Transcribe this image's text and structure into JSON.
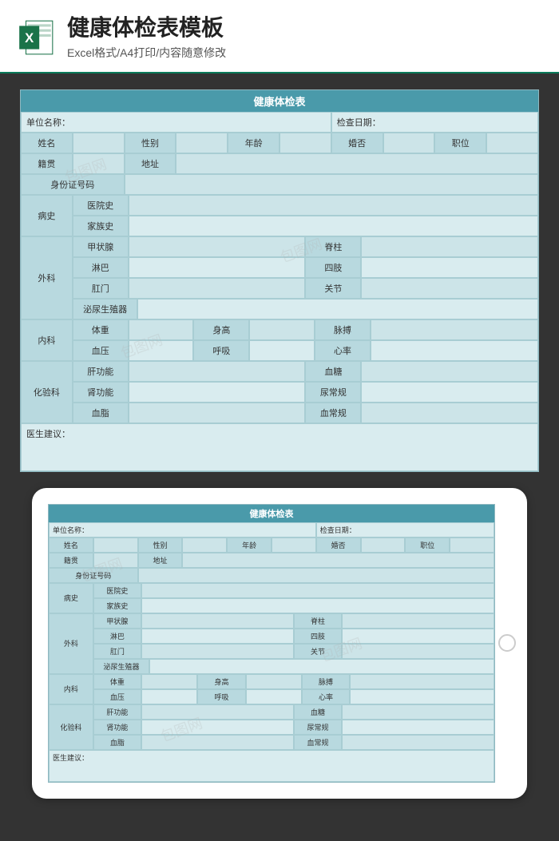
{
  "header": {
    "title": "健康体检表模板",
    "subtitle": "Excel格式/A4打印/内容随意修改"
  },
  "sheet": {
    "title": "健康体检表",
    "org_label": "单位名称：",
    "date_label": "检查日期：",
    "name": "姓名",
    "gender": "性别",
    "age": "年龄",
    "marital": "婚否",
    "position": "职位",
    "origin": "籍贯",
    "address": "地址",
    "id_no": "身份证号码",
    "history": "病史",
    "hospital_history": "医院史",
    "family_history": "家族史",
    "surgery": "外科",
    "thyroid": "甲状腺",
    "spine": "脊柱",
    "lymph": "淋巴",
    "limbs": "四肢",
    "anus": "肛门",
    "joints": "关节",
    "urogenital": "泌尿生殖器",
    "internal": "内科",
    "weight": "体重",
    "height": "身高",
    "pulse": "脉搏",
    "bp": "血压",
    "breath": "呼吸",
    "hr": "心率",
    "lab": "化验科",
    "liver": "肝功能",
    "sugar": "血糖",
    "kidney": "肾功能",
    "urine": "尿常规",
    "lipid": "血脂",
    "blood": "血常规",
    "suggestion": "医生建议："
  },
  "watermark": "包图网"
}
